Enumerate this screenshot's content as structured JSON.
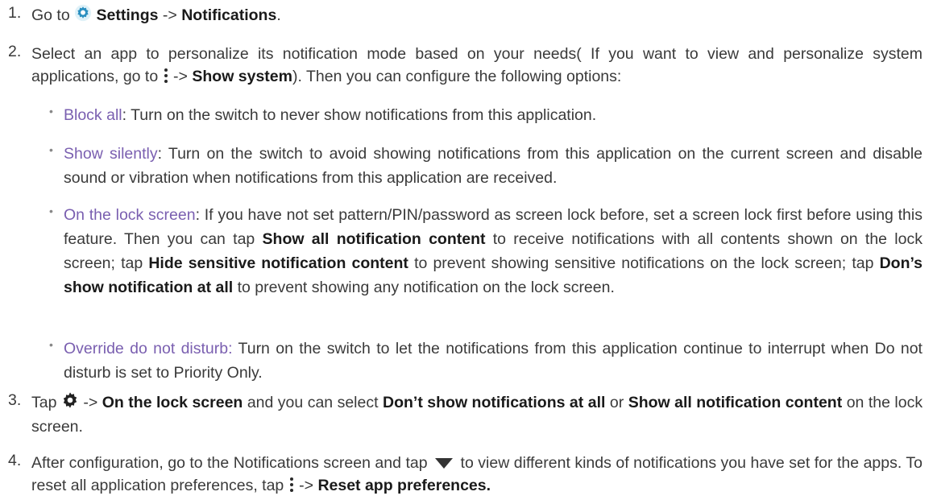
{
  "step1": {
    "num": "1.",
    "text_before": "Go to",
    "settings_label": "Settings",
    "arrow": "->",
    "notifications_label": "Notifications",
    "end": ".",
    "icon": "gear-icon"
  },
  "step2": {
    "num": "2.",
    "text_a": "Select an app to personalize its notification mode based on your needs( If you want to view and personalize system applications, go to",
    "arrow": "->",
    "show_system": "Show system",
    "text_b": "). Then you can configure the following options:",
    "icon": "more-vert-icon",
    "bullets": [
      {
        "term": "Block all",
        "text": ": Turn on the switch to never show notifications from this application."
      },
      {
        "term": "Show silently",
        "text": ": Turn on the switch to avoid showing notifications from this application on the current screen and disable sound or vibration when notifications from this application are received."
      },
      {
        "term": "On the lock screen",
        "text_a": ": If you have not set pattern/PIN/password as screen lock before, set a screen lock first before using this feature. Then you can tap",
        "bold_a": "Show all notification content",
        "text_b": "to receive notifications with all contents shown on the lock screen; tap",
        "bold_b": "Hide sensitive notification content",
        "text_c": "to prevent showing sensitive notifications on the lock screen; tap",
        "bold_c": "Don’s show notification at all",
        "text_d": "to prevent showing any notification on the lock screen."
      },
      {
        "term": "Override do not disturb:",
        "text": "Turn on the switch to let the notifications from this application continue to interrupt when Do not disturb is set to Priority Only."
      }
    ]
  },
  "step3": {
    "num": "3.",
    "tap": "Tap",
    "arrow": "->",
    "lock_screen": "On the lock screen",
    "text_a": "and you can select",
    "bold_a": "Don’t show notifications at all",
    "or": "or",
    "bold_b": "Show all notification content",
    "text_b": "on the lock screen.",
    "icon": "settings-gear-icon"
  },
  "step4": {
    "num": "4.",
    "text_a": "After configuration, go to the Notifications screen and tap",
    "text_b": "to view different kinds of notifications you have set for the apps. To reset all application preferences, tap",
    "arrow": "->",
    "reset": "Reset app preferences.",
    "icons": [
      "dropdown-triangle-icon",
      "more-vert-icon"
    ]
  }
}
